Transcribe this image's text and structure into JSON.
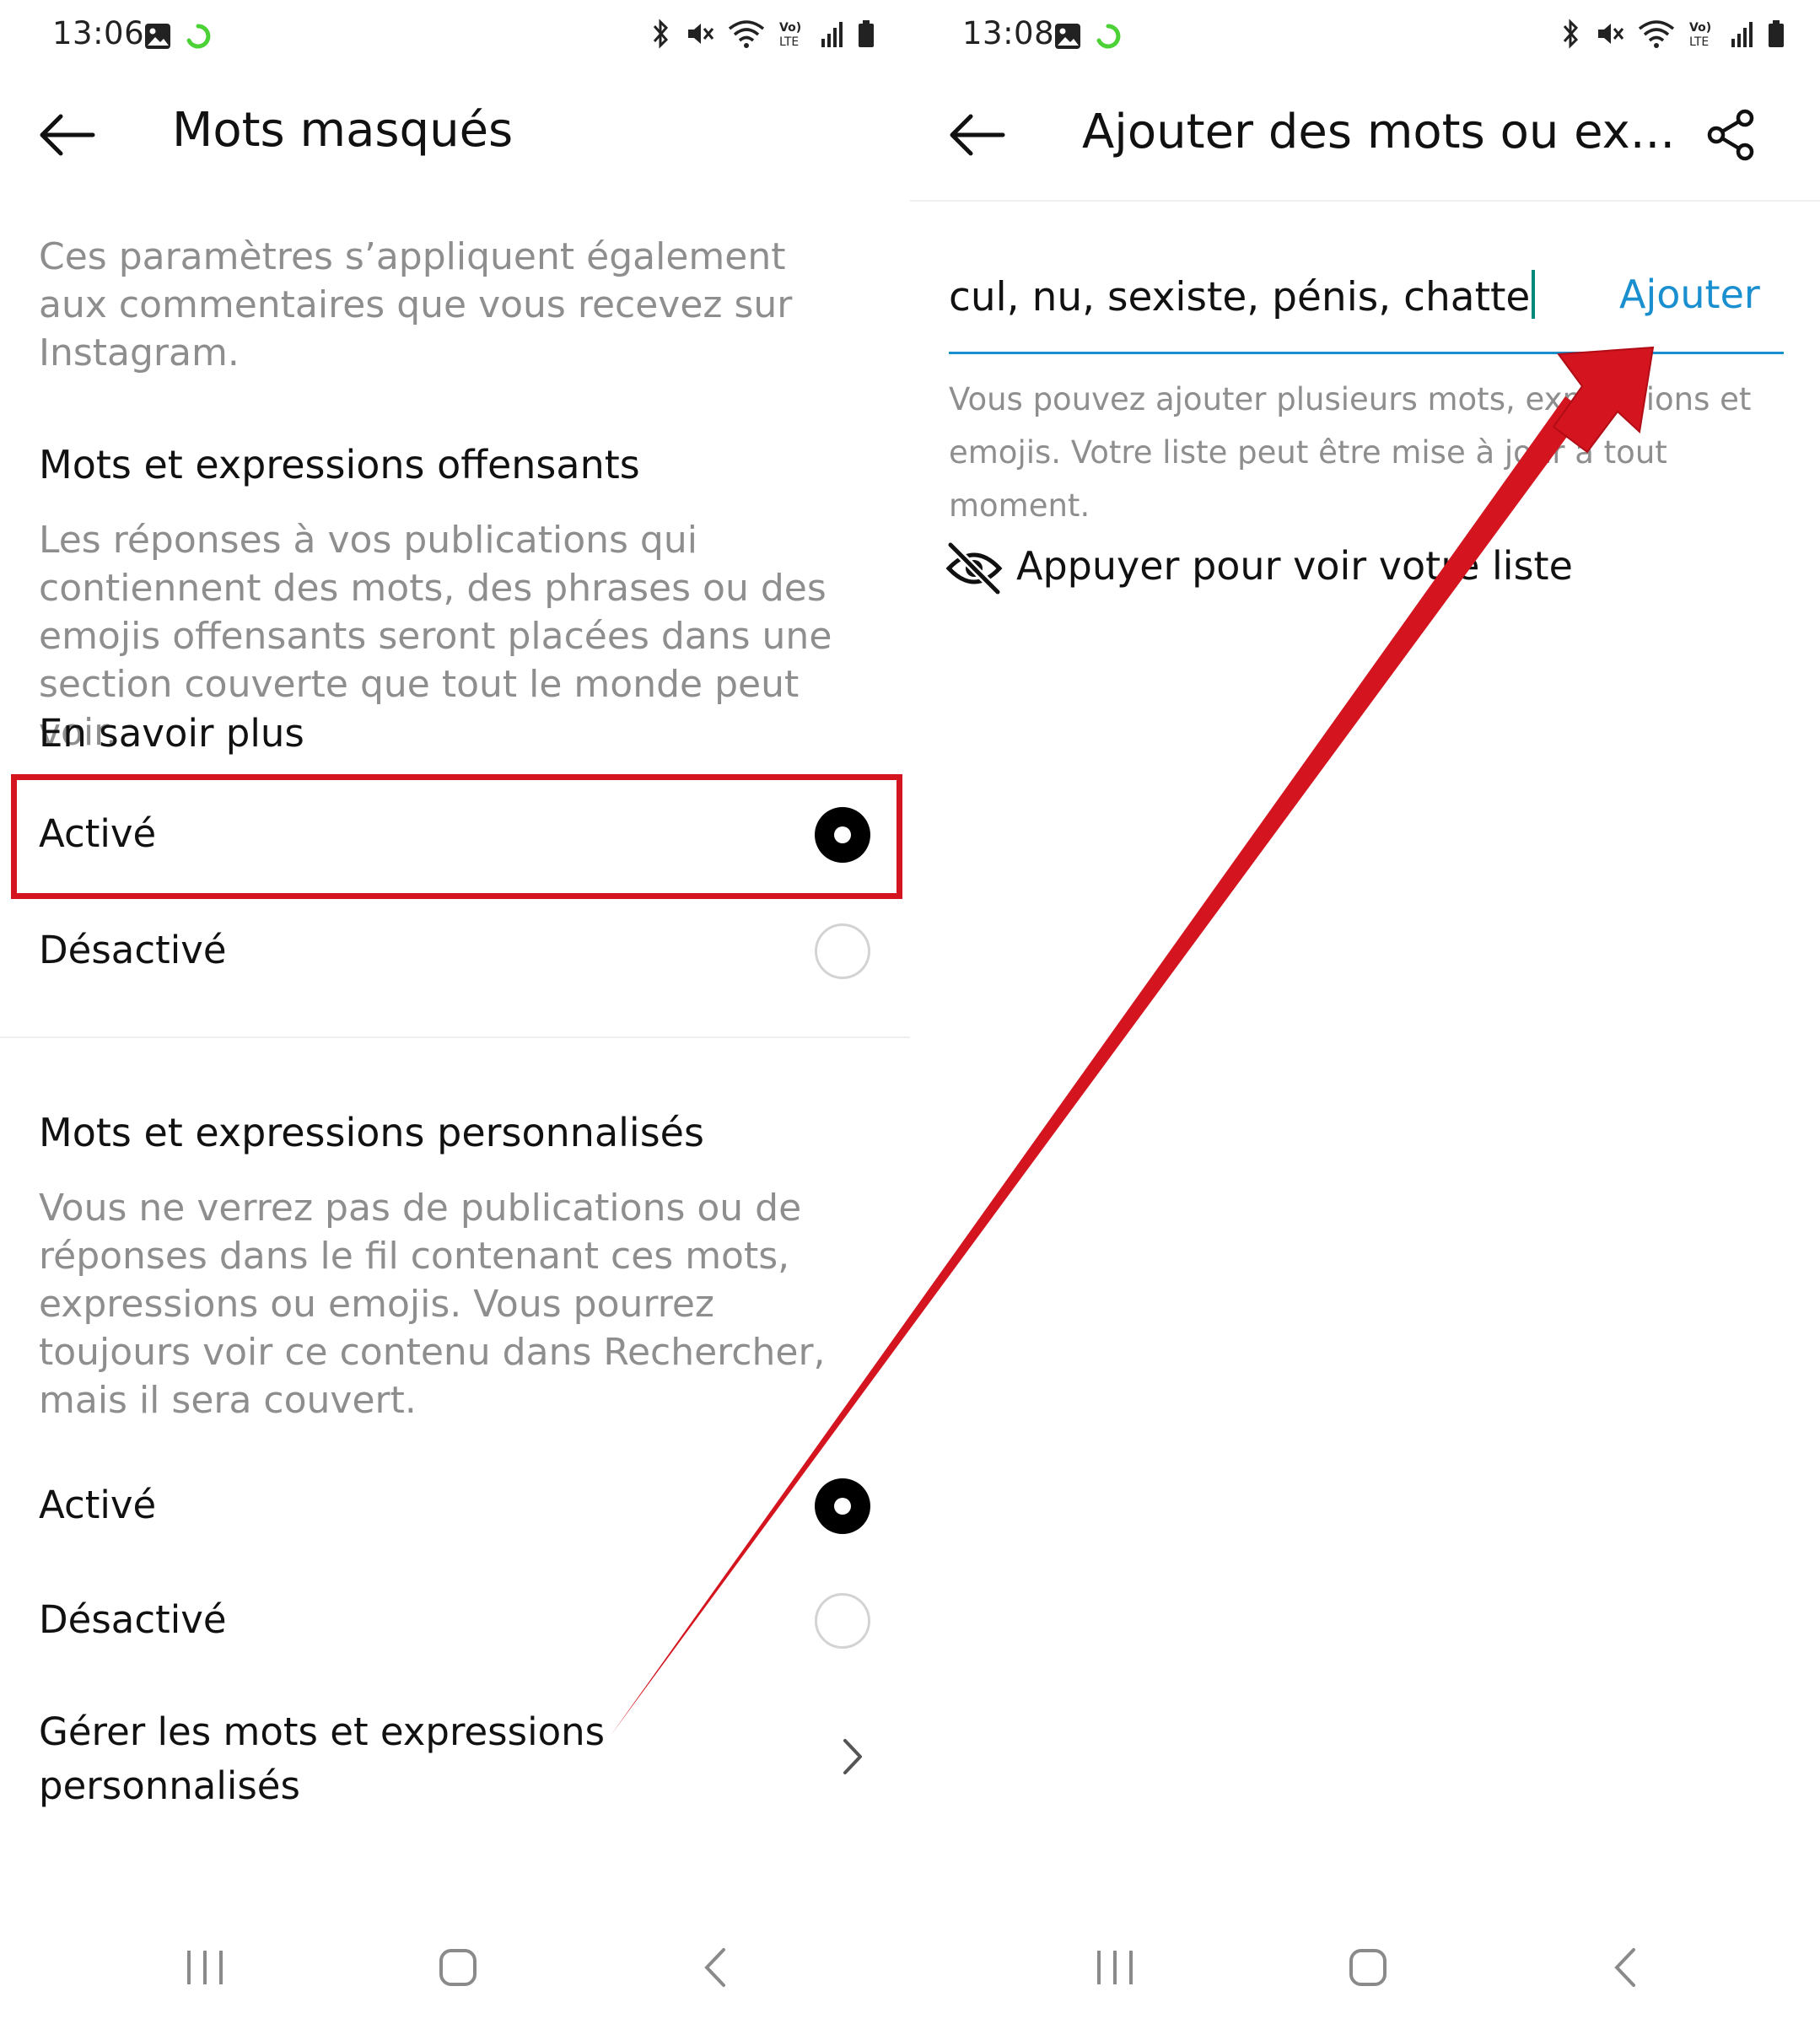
{
  "left": {
    "status": {
      "time": "13:06"
    },
    "header": {
      "title": "Mots masqués"
    },
    "intro": "Ces paramètres s’appliquent également aux commentaires que vous recevez sur Instagram.",
    "offensive": {
      "heading": "Mots et expressions offensants",
      "description": "Les réponses à vos publications qui contiennent des mots, des phrases ou des emojis offensants seront placées dans une section couverte que tout le monde peut voir.",
      "learn_more": "En savoir plus",
      "option_on": "Activé",
      "option_off": "Désactivé",
      "selected": "on"
    },
    "custom": {
      "heading": "Mots et expressions personnalisés",
      "description": "Vous ne verrez pas de publications ou de réponses dans le fil contenant ces mots, expressions ou emojis. Vous pourrez toujours voir ce contenu dans Rechercher, mais il sera couvert.",
      "option_on": "Activé",
      "option_off": "Désactivé",
      "selected": "on",
      "manage_line1": "Gérer les mots et expressions",
      "manage_line2": "personnalisés"
    }
  },
  "right": {
    "status": {
      "time": "13:08"
    },
    "header": {
      "title": "Ajouter des mots ou ex..."
    },
    "input": {
      "value": "cul, nu, sexiste, pénis, chatte"
    },
    "add_label": "Ajouter",
    "helper": "Vous pouvez ajouter plusieurs mots, expressions et emojis. Votre liste peut être mise à jour à tout moment.",
    "view_list": "Appuyer pour voir votre liste"
  },
  "colors": {
    "accent_blue": "#1a8fd0",
    "annotation_red": "#d4141e",
    "muted_text": "#8e8e8e",
    "cursor_teal": "#00897b"
  },
  "icons": [
    "back-arrow-icon",
    "share-icon",
    "eye-off-icon",
    "chevron-right-icon",
    "bluetooth-icon",
    "mute-icon",
    "wifi-icon",
    "volte-icon",
    "signal-icon",
    "battery-icon",
    "gallery-icon",
    "sync-icon",
    "recent-apps-icon",
    "home-icon",
    "nav-back-icon"
  ]
}
